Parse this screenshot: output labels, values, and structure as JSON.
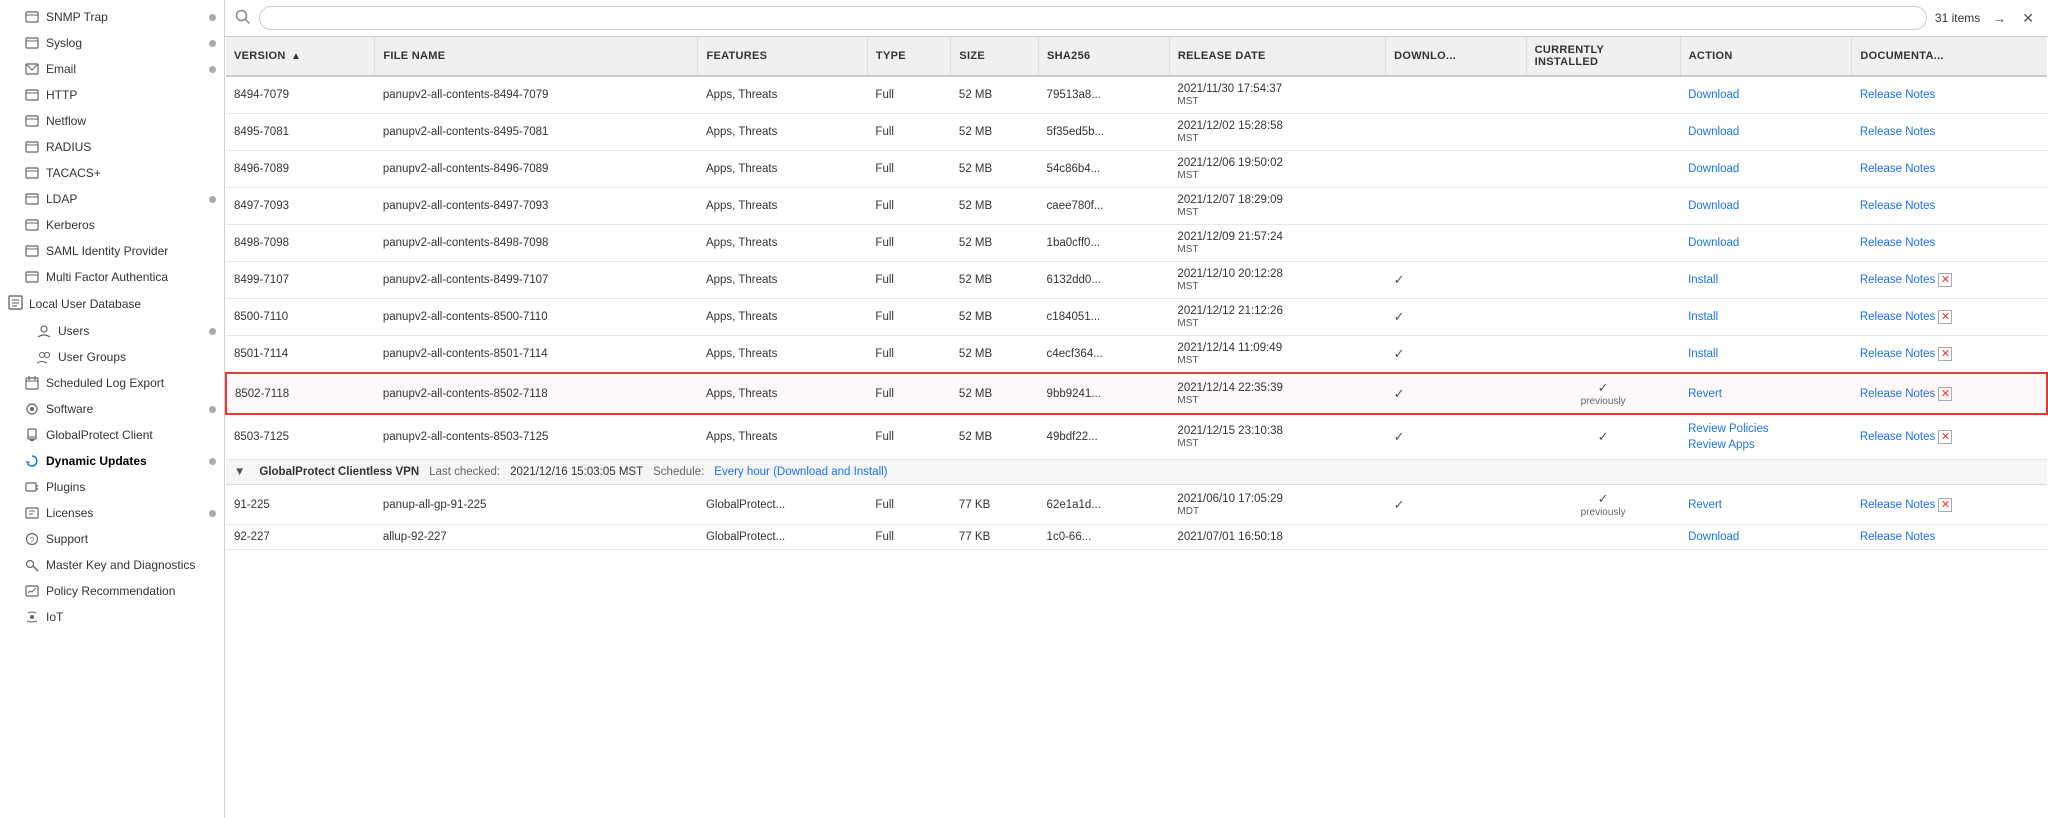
{
  "sidebar": {
    "items": [
      {
        "id": "snmp-trap",
        "label": "SNMP Trap",
        "icon": "📋",
        "dot": true,
        "indent": 1
      },
      {
        "id": "syslog",
        "label": "Syslog",
        "icon": "📋",
        "dot": true,
        "indent": 1
      },
      {
        "id": "email",
        "label": "Email",
        "icon": "📧",
        "dot": true,
        "indent": 1
      },
      {
        "id": "http",
        "label": "HTTP",
        "icon": "📋",
        "dot": false,
        "indent": 1
      },
      {
        "id": "netflow",
        "label": "Netflow",
        "icon": "📋",
        "dot": false,
        "indent": 1
      },
      {
        "id": "radius",
        "label": "RADIUS",
        "icon": "📋",
        "dot": false,
        "indent": 1
      },
      {
        "id": "tacacs",
        "label": "TACACS+",
        "icon": "📋",
        "dot": false,
        "indent": 1
      },
      {
        "id": "ldap",
        "label": "LDAP",
        "icon": "📋",
        "dot": true,
        "indent": 1
      },
      {
        "id": "kerberos",
        "label": "Kerberos",
        "icon": "📋",
        "dot": false,
        "indent": 1
      },
      {
        "id": "saml",
        "label": "SAML Identity Provider",
        "icon": "📋",
        "dot": false,
        "indent": 1
      },
      {
        "id": "mfa",
        "label": "Multi Factor Authentica",
        "icon": "📋",
        "dot": false,
        "indent": 1
      },
      {
        "id": "local-user-db",
        "label": "Local User Database",
        "icon": "🗃️",
        "dot": false,
        "indent": 0,
        "isGroup": true
      },
      {
        "id": "users",
        "label": "Users",
        "icon": "👤",
        "dot": true,
        "indent": 2
      },
      {
        "id": "user-groups",
        "label": "User Groups",
        "icon": "👥",
        "dot": false,
        "indent": 2
      },
      {
        "id": "scheduled-log-export",
        "label": "Scheduled Log Export",
        "icon": "📅",
        "dot": false,
        "indent": 1
      },
      {
        "id": "software",
        "label": "Software",
        "icon": "💿",
        "dot": true,
        "indent": 1
      },
      {
        "id": "globalprotect-client",
        "label": "GlobalProtect Client",
        "icon": "🔒",
        "dot": false,
        "indent": 1
      },
      {
        "id": "dynamic-updates",
        "label": "Dynamic Updates",
        "icon": "🔄",
        "dot": true,
        "indent": 1,
        "active": true
      },
      {
        "id": "plugins",
        "label": "Plugins",
        "icon": "🔌",
        "dot": false,
        "indent": 1
      },
      {
        "id": "licenses",
        "label": "Licenses",
        "icon": "📄",
        "dot": true,
        "indent": 1
      },
      {
        "id": "support",
        "label": "Support",
        "icon": "🔧",
        "dot": false,
        "indent": 1
      },
      {
        "id": "master-key",
        "label": "Master Key and Diagnostics",
        "icon": "🔑",
        "dot": false,
        "indent": 1
      },
      {
        "id": "policy-rec",
        "label": "Policy Recommendation",
        "icon": "📊",
        "dot": false,
        "indent": 1
      },
      {
        "id": "iot",
        "label": "IoT",
        "icon": "📡",
        "dot": false,
        "indent": 1
      }
    ]
  },
  "search": {
    "placeholder": "",
    "items_count": "31 items"
  },
  "table": {
    "columns": [
      {
        "id": "version",
        "label": "VERSION",
        "sortable": true,
        "sort": "asc"
      },
      {
        "id": "filename",
        "label": "FILE NAME"
      },
      {
        "id": "features",
        "label": "FEATURES"
      },
      {
        "id": "type",
        "label": "TYPE"
      },
      {
        "id": "size",
        "label": "SIZE"
      },
      {
        "id": "sha256",
        "label": "SHA256"
      },
      {
        "id": "release_date",
        "label": "RELEASE DATE"
      },
      {
        "id": "download",
        "label": "DOWNLO..."
      },
      {
        "id": "currently_installed",
        "label": "CURRENTLY INSTALLED"
      },
      {
        "id": "action",
        "label": "ACTION"
      },
      {
        "id": "documentation",
        "label": "DOCUMENTA..."
      }
    ],
    "rows": [
      {
        "version": "8494-7079",
        "filename": "panupv2-all-contents-8494-7079",
        "features": "Apps, Threats",
        "type": "Full",
        "size": "52 MB",
        "sha256": "79513a8...",
        "release_date": "2021/11/30 17:54:37\nMST",
        "downloaded": false,
        "currently_installed": false,
        "action": "Download",
        "has_cancel": false,
        "highlighted": false
      },
      {
        "version": "8495-7081",
        "filename": "panupv2-all-contents-8495-7081",
        "features": "Apps, Threats",
        "type": "Full",
        "size": "52 MB",
        "sha256": "5f35ed5b...",
        "release_date": "2021/12/02 15:28:58\nMST",
        "downloaded": false,
        "currently_installed": false,
        "action": "Download",
        "has_cancel": false,
        "highlighted": false
      },
      {
        "version": "8496-7089",
        "filename": "panupv2-all-contents-8496-7089",
        "features": "Apps, Threats",
        "type": "Full",
        "size": "52 MB",
        "sha256": "54c86b4...",
        "release_date": "2021/12/06 19:50:02\nMST",
        "downloaded": false,
        "currently_installed": false,
        "action": "Download",
        "has_cancel": false,
        "highlighted": false
      },
      {
        "version": "8497-7093",
        "filename": "panupv2-all-contents-8497-7093",
        "features": "Apps, Threats",
        "type": "Full",
        "size": "52 MB",
        "sha256": "caee780f...",
        "release_date": "2021/12/07 18:29:09\nMST",
        "downloaded": false,
        "currently_installed": false,
        "action": "Download",
        "has_cancel": false,
        "highlighted": false
      },
      {
        "version": "8498-7098",
        "filename": "panupv2-all-contents-8498-7098",
        "features": "Apps, Threats",
        "type": "Full",
        "size": "52 MB",
        "sha256": "1ba0cff0...",
        "release_date": "2021/12/09 21:57:24\nMST",
        "downloaded": false,
        "currently_installed": false,
        "action": "Download",
        "has_cancel": false,
        "highlighted": false
      },
      {
        "version": "8499-7107",
        "filename": "panupv2-all-contents-8499-7107",
        "features": "Apps, Threats",
        "type": "Full",
        "size": "52 MB",
        "sha256": "6132dd0...",
        "release_date": "2021/12/10 20:12:28\nMST",
        "downloaded": true,
        "currently_installed": false,
        "action": "Install",
        "has_cancel": true,
        "highlighted": false
      },
      {
        "version": "8500-7110",
        "filename": "panupv2-all-contents-8500-7110",
        "features": "Apps, Threats",
        "type": "Full",
        "size": "52 MB",
        "sha256": "c184051...",
        "release_date": "2021/12/12 21:12:26\nMST",
        "downloaded": true,
        "currently_installed": false,
        "action": "Install",
        "has_cancel": true,
        "highlighted": false
      },
      {
        "version": "8501-7114",
        "filename": "panupv2-all-contents-8501-7114",
        "features": "Apps, Threats",
        "type": "Full",
        "size": "52 MB",
        "sha256": "c4ecf364...",
        "release_date": "2021/12/14 11:09:49\nMST",
        "downloaded": true,
        "currently_installed": false,
        "action": "Install",
        "has_cancel": true,
        "highlighted": false
      },
      {
        "version": "8502-7118",
        "filename": "panupv2-all-contents-8502-7118",
        "features": "Apps, Threats",
        "type": "Full",
        "size": "52 MB",
        "sha256": "9bb9241...",
        "release_date": "2021/12/14 22:35:39\nMST",
        "downloaded": true,
        "currently_installed": false,
        "previously": true,
        "action": "Revert",
        "has_cancel": true,
        "highlighted": true
      },
      {
        "version": "8503-7125",
        "filename": "panupv2-all-contents-8503-7125",
        "features": "Apps, Threats",
        "type": "Full",
        "size": "52 MB",
        "sha256": "49bdf22...",
        "release_date": "2021/12/15 23:10:38\nMST",
        "downloaded": true,
        "currently_installed": true,
        "action": "Review Policies\nReview Apps",
        "has_cancel": true,
        "highlighted": false
      }
    ],
    "gp_section": {
      "title": "GlobalProtect Clientless VPN",
      "last_checked_label": "Last checked:",
      "last_checked_value": "2021/12/16 15:03:05 MST",
      "schedule_label": "Schedule:",
      "schedule_value": "Every hour (Download and Install)"
    },
    "gp_rows": [
      {
        "version": "91-225",
        "filename": "panup-all-gp-91-225",
        "features": "GlobalProtect...",
        "type": "Full",
        "size": "77 KB",
        "sha256": "62e1a1d...",
        "release_date": "2021/06/10 17:05:29\nMDT",
        "downloaded": true,
        "currently_installed": false,
        "previously": true,
        "action": "Revert",
        "has_cancel": true,
        "highlighted": false
      },
      {
        "version": "92-227",
        "filename": "allup-92-227",
        "features": "GlobalProtect...",
        "type": "Full",
        "size": "77 KB",
        "sha256": "1c0-66...",
        "release_date": "2021/07/01 16:50:18",
        "downloaded": false,
        "currently_installed": false,
        "action": "Download",
        "has_cancel": false,
        "highlighted": false
      }
    ],
    "release_notes_label": "Release Notes",
    "download_label": "Download",
    "install_label": "Install",
    "revert_label": "Revert",
    "review_policies_label": "Review Policies",
    "review_apps_label": "Review Apps"
  }
}
